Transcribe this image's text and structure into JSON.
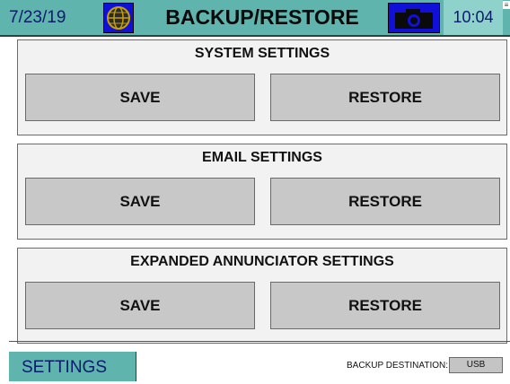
{
  "header": {
    "date": "7/23/19",
    "title": "BACKUP/RESTORE",
    "time": "10:04",
    "left_icon": "globe-icon",
    "right_icon": "camera-icon",
    "color": "#5fb5ad"
  },
  "sections": [
    {
      "title": "SYSTEM SETTINGS",
      "save_label": "SAVE",
      "restore_label": "RESTORE"
    },
    {
      "title": "EMAIL SETTINGS",
      "save_label": "SAVE",
      "restore_label": "RESTORE"
    },
    {
      "title": "EXPANDED ANNUNCIATOR SETTINGS",
      "save_label": "SAVE",
      "restore_label": "RESTORE"
    }
  ],
  "footer": {
    "settings_label": "SETTINGS",
    "backup_destination_label": "BACKUP DESTINATION:",
    "backup_destination_value": "USB"
  }
}
